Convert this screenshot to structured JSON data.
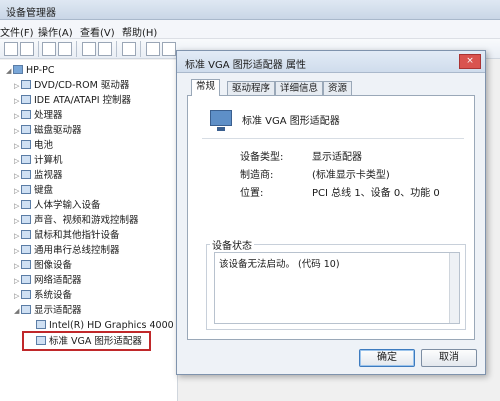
{
  "window": {
    "title": "设备管理器",
    "menu": [
      "文件(F)",
      "操作(A)",
      "查看(V)",
      "帮助(H)"
    ]
  },
  "tree": {
    "root": "HP-PC",
    "items": [
      "DVD/CD-ROM 驱动器",
      "IDE ATA/ATAPI 控制器",
      "处理器",
      "磁盘驱动器",
      "电池",
      "计算机",
      "监视器",
      "键盘",
      "人体学输入设备",
      "声音、视频和游戏控制器",
      "鼠标和其他指针设备",
      "通用串行总线控制器",
      "图像设备",
      "网络适配器",
      "系统设备",
      "显示适配器"
    ],
    "display_children": [
      "Intel(R) HD Graphics 4000",
      "标准 VGA 图形适配器"
    ]
  },
  "dialog": {
    "title": "标准 VGA 图形适配器 属性",
    "close_icon": "×",
    "tabs": [
      "常规",
      "驱动程序",
      "详细信息",
      "资源"
    ],
    "device_name": "标准 VGA 图形适配器",
    "fields": [
      {
        "label": "设备类型:",
        "value": "显示适配器"
      },
      {
        "label": "制造商:",
        "value": "(标准显示卡类型)"
      },
      {
        "label": "位置:",
        "value": "PCI 总线 1、设备 0、功能 0"
      }
    ],
    "status_label": "设备状态",
    "status_text": "该设备无法启动。 (代码 10)",
    "ok_label": "确定",
    "cancel_label": "取消"
  }
}
